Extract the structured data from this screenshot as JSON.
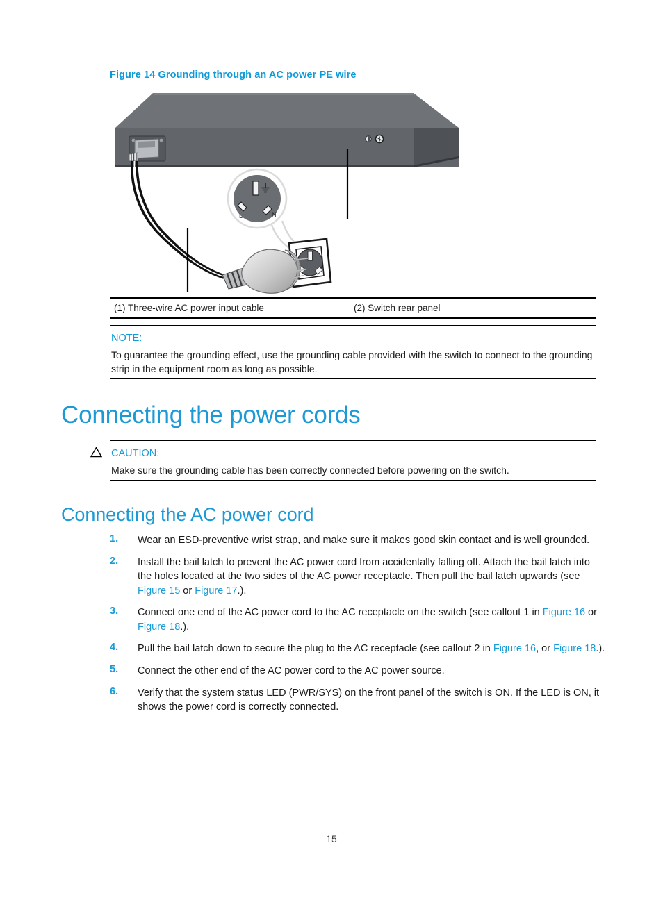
{
  "figure": {
    "title": "Figure 14 Grounding through an AC power PE wire",
    "illustration_name": "ac-power-pe-wire-grounding-diagram",
    "socket_markings": {
      "live": "L",
      "neutral": "N"
    },
    "callouts": [
      {
        "id": "1",
        "label": "(1) Three-wire AC power input cable"
      },
      {
        "id": "2",
        "label": "(2) Switch rear panel"
      }
    ]
  },
  "note": {
    "label": "NOTE:",
    "body": "To guarantee the grounding effect, use the grounding cable provided with the switch to connect to the grounding strip in the equipment room as long as possible."
  },
  "headings": {
    "h1": "Connecting the power cords",
    "h2": "Connecting the AC power cord"
  },
  "caution": {
    "icon": "warning-triangle-icon",
    "label": "CAUTION:",
    "body": "Make sure the grounding cable has been correctly connected before powering on the switch."
  },
  "steps": [
    {
      "num": "1.",
      "parts": [
        {
          "t": "Wear an ESD-preventive wrist strap, and make sure it makes good skin contact and is well grounded.",
          "link": false
        }
      ]
    },
    {
      "num": "2.",
      "parts": [
        {
          "t": "Install the bail latch to prevent the AC power cord from accidentally falling off. Attach the bail latch into the holes located at the two sides of the AC power receptacle. Then pull the bail latch upwards (see ",
          "link": false
        },
        {
          "t": "Figure 15",
          "link": true
        },
        {
          "t": " or ",
          "link": false
        },
        {
          "t": "Figure 17",
          "link": true
        },
        {
          "t": ".).",
          "link": false
        }
      ]
    },
    {
      "num": "3.",
      "parts": [
        {
          "t": "Connect one end of the AC power cord to the AC receptacle on the switch (see callout 1 in ",
          "link": false
        },
        {
          "t": "Figure 16",
          "link": true
        },
        {
          "t": " or ",
          "link": false
        },
        {
          "t": "Figure 18",
          "link": true
        },
        {
          "t": ".).",
          "link": false
        }
      ]
    },
    {
      "num": "4.",
      "parts": [
        {
          "t": "Pull the bail latch down to secure the plug to the AC receptacle (see callout 2 in ",
          "link": false
        },
        {
          "t": "Figure 16",
          "link": true
        },
        {
          "t": ", or ",
          "link": false
        },
        {
          "t": "Figure 18",
          "link": true
        },
        {
          "t": ".).",
          "link": false
        }
      ]
    },
    {
      "num": "5.",
      "parts": [
        {
          "t": "Connect the other end of the AC power cord to the AC power source.",
          "link": false
        }
      ]
    },
    {
      "num": "6.",
      "parts": [
        {
          "t": "Verify that the system status LED (PWR/SYS) on the front panel of the switch is ON. If the LED is ON, it shows the power cord is correctly connected.",
          "link": false
        }
      ]
    }
  ],
  "footer": {
    "page_number": "15"
  },
  "colors": {
    "accent_blue": "#1c9ad6",
    "figure_title_blue": "#0c9bd8",
    "body_text": "#1a1a1a",
    "rule": "#000000"
  }
}
